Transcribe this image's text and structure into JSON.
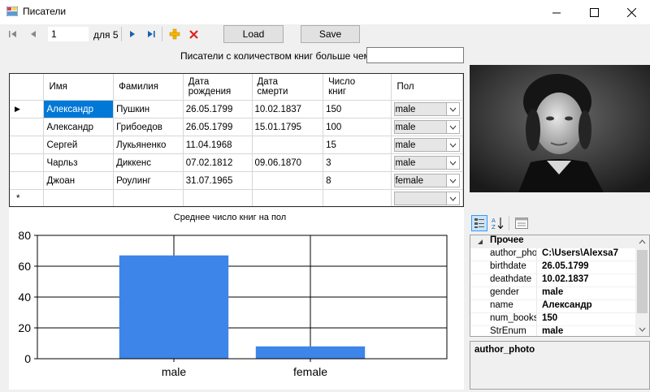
{
  "window": {
    "title": "Писатели"
  },
  "navigator": {
    "position": "1",
    "of_label": "для 5"
  },
  "buttons": {
    "load": "Load",
    "save": "Save"
  },
  "filter": {
    "label": "Писатели с количеством книг больше чем:",
    "value": ""
  },
  "grid": {
    "columns": [
      "Имя",
      "Фамилия",
      "Дата рождения",
      "Дата смерти",
      "Число книг",
      "Пол"
    ],
    "rows": [
      {
        "name": "Александр",
        "surname": "Пушкин",
        "birth": "26.05.1799",
        "death": "10.02.1837",
        "books": "150",
        "gender": "male"
      },
      {
        "name": "Александр",
        "surname": "Грибоедов",
        "birth": "26.05.1799",
        "death": "15.01.1795",
        "books": "100",
        "gender": "male"
      },
      {
        "name": "Сергей",
        "surname": "Лукьяненко",
        "birth": "11.04.1968",
        "death": "",
        "books": "15",
        "gender": "male"
      },
      {
        "name": "Чарльз",
        "surname": "Диккенс",
        "birth": "07.02.1812",
        "death": "09.06.1870",
        "books": "3",
        "gender": "male"
      },
      {
        "name": "Джоан",
        "surname": "Роулинг",
        "birth": "31.07.1965",
        "death": "",
        "books": "8",
        "gender": "female"
      }
    ],
    "new_row_marker": "*",
    "current_row_marker": "▶"
  },
  "chart_data": {
    "type": "bar",
    "title": "Среднее число книг на пол",
    "categories": [
      "male",
      "female"
    ],
    "values": [
      67,
      8
    ],
    "ylim": [
      0,
      80
    ],
    "yticks": [
      "0",
      "20",
      "40",
      "60",
      "80"
    ],
    "grid": true,
    "bar_color": "#3d85e8"
  },
  "property_grid": {
    "category": "Прочее",
    "rows": [
      {
        "key": "author_photo",
        "value": "C:\\Users\\Alexsa7"
      },
      {
        "key": "birthdate",
        "value": "26.05.1799"
      },
      {
        "key": "deathdate",
        "value": "10.02.1837"
      },
      {
        "key": "gender",
        "value": "male"
      },
      {
        "key": "name",
        "value": "Александр"
      },
      {
        "key": "num_books",
        "value": "150"
      },
      {
        "key": "StrEnum",
        "value": "male"
      }
    ],
    "description_title": "author_photo"
  },
  "colors": {
    "selection": "#0078d7",
    "bar": "#3d85e8"
  }
}
